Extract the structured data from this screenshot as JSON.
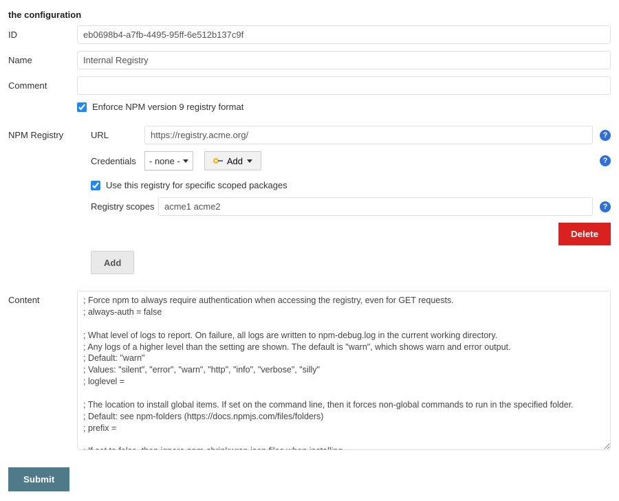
{
  "section": {
    "title": "the configuration"
  },
  "fields": {
    "id": {
      "label": "ID",
      "value": "eb0698b4-a7fb-4495-95ff-6e512b137c9f"
    },
    "name": {
      "label": "Name",
      "value": "Internal Registry"
    },
    "comment": {
      "label": "Comment",
      "value": ""
    },
    "npm_registry": {
      "label": "NPM Registry"
    },
    "content": {
      "label": "Content"
    }
  },
  "npm": {
    "enforce_v9": {
      "label": "Enforce NPM version 9 registry format",
      "checked": true
    },
    "url": {
      "label": "URL",
      "value": "https://registry.acme.org/"
    },
    "credentials": {
      "label": "Credentials",
      "selected": "- none -",
      "add_label": "Add"
    },
    "scoped_check": {
      "label": "Use this registry for specific scoped packages",
      "checked": true
    },
    "scopes": {
      "label": "Registry scopes",
      "value": "acme1 acme2"
    }
  },
  "buttons": {
    "delete": "Delete",
    "add": "Add",
    "submit": "Submit"
  },
  "content_text": "; Force npm to always require authentication when accessing the registry, even for GET requests.\n; always-auth = false\n\n; What level of logs to report. On failure, all logs are written to npm-debug.log in the current working directory.\n; Any logs of a higher level than the setting are shown. The default is \"warn\", which shows warn and error output.\n; Default: \"warn\"\n; Values: \"silent\", \"error\", \"warn\", \"http\", \"info\", \"verbose\", \"silly\"\n; loglevel =\n\n; The location to install global items. If set on the command line, then it forces non-global commands to run in the specified folder.\n; Default: see npm-folders (https://docs.npmjs.com/files/folders)\n; prefix =\n\n; If set to false, then ignore npm-shrinkwrap.json files when installing.\n; Default: true\n; shrinkwrap ="
}
